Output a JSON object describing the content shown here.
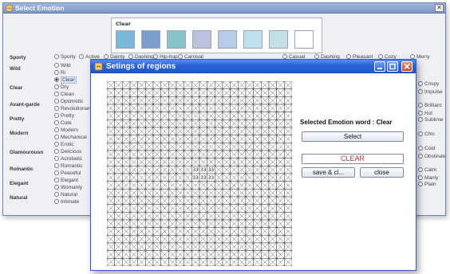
{
  "main_window": {
    "title": "Select Emotion",
    "close_glyph": "✕",
    "panel_label": "Clear",
    "swatches": [
      "#7ab8d8",
      "#7a9fcd",
      "#8ac2c9",
      "#bcc2de",
      "#b8cce8",
      "#bfe0f1",
      "#c2e0e4",
      "#ffffff"
    ]
  },
  "header_row": [
    "Sporty",
    "Active",
    "Dainty",
    "Dashing",
    "Hip-hop",
    "Casual",
    "Casual",
    "Dashing",
    "Pleasant",
    "Cozy",
    "Merry"
  ],
  "rows": [
    {
      "category": "Sporty",
      "options": [
        "Sporty",
        "Active",
        "Dainty",
        "Dashing",
        "Hip-hop",
        "Carnival"
      ],
      "right": [
        "Casual",
        "Dashing",
        "Pleasant",
        "Cozy",
        "Merry"
      ]
    },
    {
      "category": "Wild",
      "options": [
        "Wild",
        "Ri"
      ],
      "right": [],
      "far": []
    },
    {
      "category": "Clear",
      "options": [
        "Clear",
        "Dry",
        "Clean"
      ],
      "far": [
        "Crispy",
        "Impulse"
      ]
    },
    {
      "category": "Avant-garde",
      "options": [
        "Optimistic",
        "Revolutionary"
      ],
      "far": [
        "Brilliant",
        "Hot"
      ]
    },
    {
      "category": "Pretty",
      "options": [
        "Pretty",
        "Cute"
      ],
      "far": [
        "Sublime"
      ]
    },
    {
      "category": "Modern",
      "options": [
        "Modern",
        "Mechanical"
      ],
      "far": [
        "Chic"
      ]
    },
    {
      "category": "Glamourousn",
      "options": [
        "Erotic",
        "Delicious",
        "Acrobatic"
      ],
      "far": [
        "Cold",
        "Obstinate"
      ]
    },
    {
      "category": "Romantic",
      "options": [
        "Romantic",
        "Peaceful"
      ],
      "far": [
        "Calm",
        "Manly"
      ]
    },
    {
      "category": "Elegant",
      "options": [
        "Elegant",
        "Womanly"
      ],
      "far": [
        "Plain"
      ]
    },
    {
      "category": "Natural",
      "options": [
        "Natural",
        "Intimate"
      ],
      "far": []
    }
  ],
  "dialog": {
    "title": "Setings of regions",
    "selected_label": "Selected Emotion word : Clear",
    "select_button": "Select",
    "clear_value": "CLEAR",
    "save_button": "save & cl...",
    "close_button": "close",
    "grid": {
      "rows": 24,
      "cols": 24,
      "marked_cells": [
        [
          11,
          11
        ],
        [
          11,
          12
        ],
        [
          11,
          13
        ],
        [
          12,
          11
        ],
        [
          12,
          12
        ],
        [
          12,
          13
        ]
      ],
      "marked_text": "33"
    }
  }
}
